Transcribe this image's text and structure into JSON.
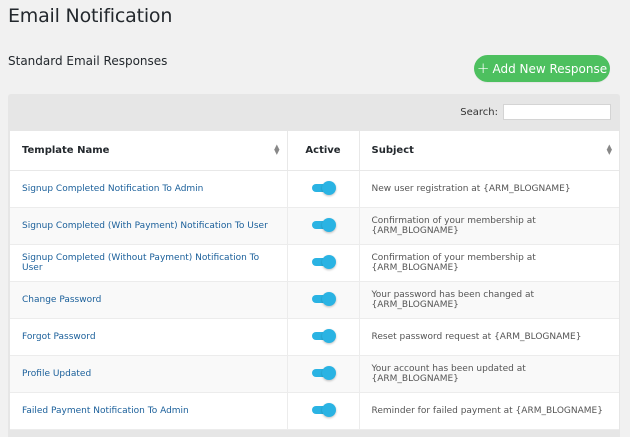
{
  "page": {
    "title": "Email Notification",
    "section_title": "Standard Email Responses"
  },
  "actions": {
    "add_label": "Add New Response",
    "add_icon": "plus-icon"
  },
  "search": {
    "label": "Search:",
    "value": ""
  },
  "table": {
    "headers": {
      "name": "Template Name",
      "active": "Active",
      "subject": "Subject"
    },
    "rows": [
      {
        "name": "Signup Completed Notification To Admin",
        "active": true,
        "subject": "New user registration at {ARM_BLOGNAME}"
      },
      {
        "name": "Signup Completed (With Payment) Notification To User",
        "active": true,
        "subject": "Confirmation of your membership at {ARM_BLOGNAME}"
      },
      {
        "name": "Signup Completed (Without Payment) Notification To User",
        "active": true,
        "subject": "Confirmation of your membership at {ARM_BLOGNAME}"
      },
      {
        "name": "Change Password",
        "active": true,
        "subject": "Your password has been changed at {ARM_BLOGNAME}"
      },
      {
        "name": "Forgot Password",
        "active": true,
        "subject": "Reset password request at {ARM_BLOGNAME}"
      },
      {
        "name": "Profile Updated",
        "active": true,
        "subject": "Your account has been updated at {ARM_BLOGNAME}"
      },
      {
        "name": "Failed Payment Notification To Admin",
        "active": true,
        "subject": "Reminder for failed payment at {ARM_BLOGNAME}"
      }
    ]
  },
  "colors": {
    "add_button": "#4dc05f",
    "toggle_on": "#2ab3e3",
    "link": "#1a5f9a"
  }
}
